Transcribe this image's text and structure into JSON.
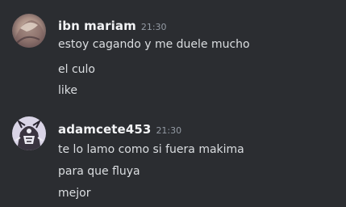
{
  "theme": {
    "background": "#2b2d31",
    "username_color": "#f2f3f5",
    "timestamp_color": "#949ba4",
    "text_color": "#dbdee1"
  },
  "messages": [
    {
      "username": "ibn mariam",
      "timestamp": "21:30",
      "avatar": "user-avatar",
      "lines": [
        "estoy cagando y me duele mucho",
        "el culo",
        "like"
      ]
    },
    {
      "username": "adamcete453",
      "timestamp": "21:30",
      "avatar": "user-avatar",
      "lines": [
        "te lo lamo como si fuera makima",
        "para que fluya",
        "mejor"
      ]
    }
  ]
}
